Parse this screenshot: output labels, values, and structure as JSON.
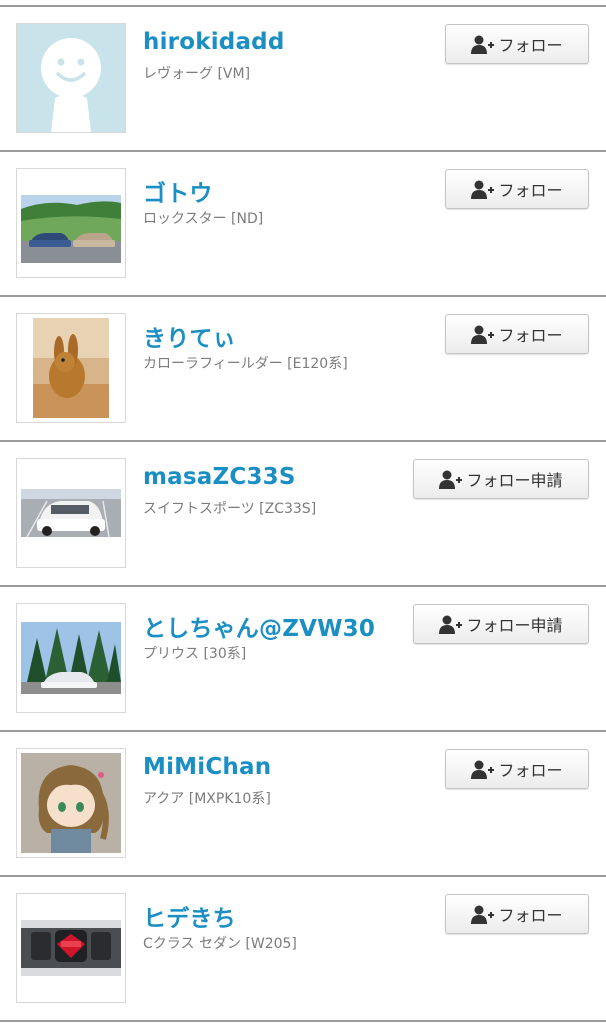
{
  "users": [
    {
      "name": "hirokidadd",
      "car": "レヴォーグ [VM]",
      "button": "フォロー",
      "avatar": "default-smiley-avatar"
    },
    {
      "name": "ゴトウ",
      "car": "ロックスター [ND]",
      "button": "フォロー",
      "avatar": "cars-on-lawn-photo"
    },
    {
      "name": "きりてぃ",
      "car": "カローラフィールダー [E120系]",
      "button": "フォロー",
      "avatar": "rabbit-photo"
    },
    {
      "name": "masaZC33S",
      "car": "スイフトスポーツ [ZC33S]",
      "button": "フォロー申請",
      "avatar": "white-swift-photo"
    },
    {
      "name": "としちゃん@ZVW30",
      "car": "プリウス [30系]",
      "button": "フォロー申請",
      "avatar": "prius-trees-photo"
    },
    {
      "name": "MiMiChan",
      "car": "アクア [MXPK10系]",
      "button": "フォロー",
      "avatar": "anime-figure-photo"
    },
    {
      "name": "ヒデきち",
      "car": "Cクラス セダン [W205]",
      "button": "フォロー",
      "avatar": "engine-bay-photo"
    }
  ],
  "colors": {
    "name": "#1b8fc4",
    "subtext": "#7c7c7c",
    "divider": "#9a9a9a",
    "button_bg": "#f2f2f2"
  },
  "icons": {
    "follow_button": "add-user-icon"
  }
}
